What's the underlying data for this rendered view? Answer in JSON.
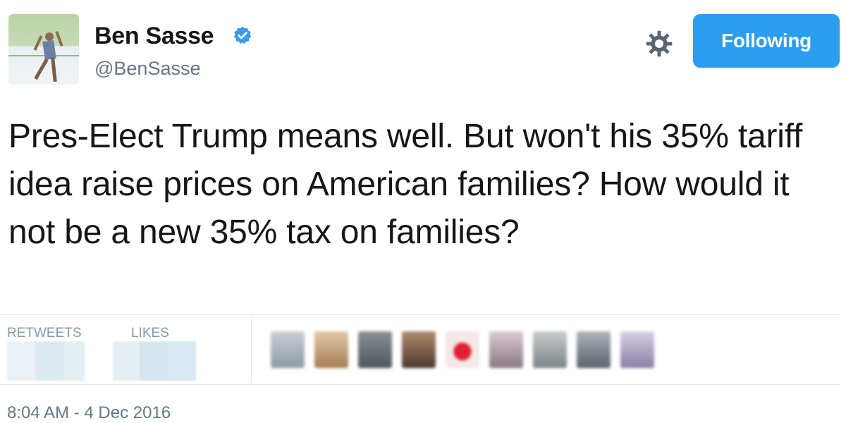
{
  "tweet": {
    "author_name": "Ben Sasse",
    "author_handle": "@BenSasse",
    "follow_button_label": "Following",
    "text": "Pres-Elect Trump means well. But won't his 35% tariff idea raise prices on American families? How would it not be a new 35% tax on families?",
    "retweets_label": "RETWEETS",
    "likes_label": "LIKES",
    "timestamp": "8:04 AM - 4 Dec 2016"
  },
  "icons": {
    "verified": "verified-badge-icon",
    "settings": "gear-icon"
  },
  "colors": {
    "accent": "#2b9ef0",
    "verified": "#3a9ce9",
    "text": "#14171a",
    "muted": "#657786",
    "label": "#8899a6",
    "divider": "#e1e8ed"
  }
}
